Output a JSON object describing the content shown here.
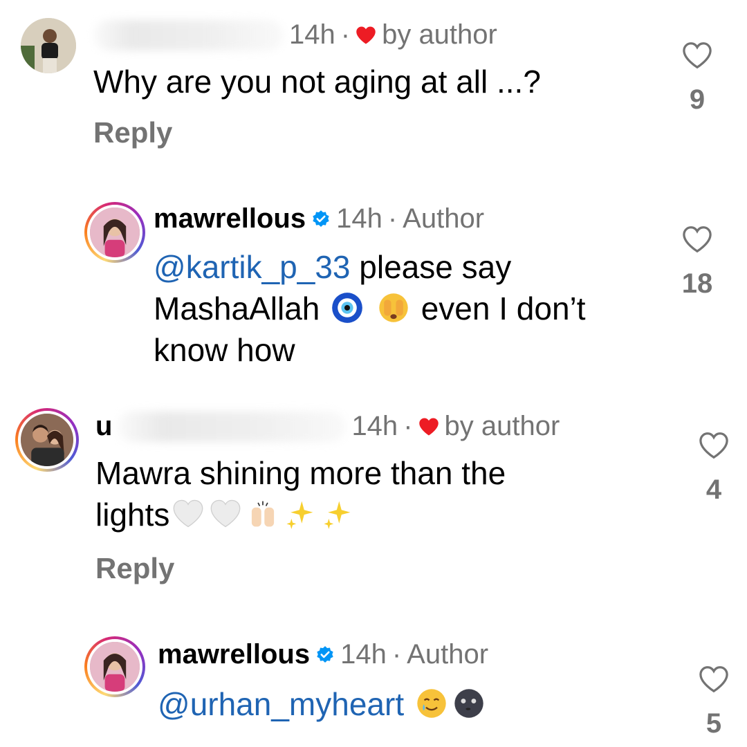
{
  "comments": [
    {
      "username_visible": "",
      "time": "14h",
      "badge": "by author",
      "text": "Why are you not aging at all ...?",
      "reply_label": "Reply",
      "likes": "9"
    },
    {
      "username": "mawrellous",
      "time": "14h",
      "badge": "Author",
      "mention": "@kartik_p_33",
      "text_part1": " please say",
      "text_part2": "MashaAllah",
      "text_part3": "even I don’t",
      "text_part4": "know how",
      "emojis": [
        "nazar-amulet-emoji",
        "face-peeking-emoji"
      ],
      "likes": "18"
    },
    {
      "username_visible": "u",
      "time": "14h",
      "badge": "by author",
      "text_part1": "Mawra shining more than the",
      "text_part2": "lights",
      "emojis": [
        "white-heart-emoji",
        "white-heart-emoji",
        "raising-hands-emoji",
        "sparkles-emoji",
        "sparkles-emoji"
      ],
      "reply_label": "Reply",
      "likes": "4"
    },
    {
      "username": "mawrellous",
      "time": "14h",
      "badge": "Author",
      "mention": "@urhan_myheart",
      "emojis": [
        "smiling-face-with-tear-emoji",
        "new-moon-face-emoji"
      ],
      "likes": "5"
    }
  ],
  "colors": {
    "muted": "#737373",
    "mention": "#1f64b3",
    "heart_red": "#ed1c24",
    "verified": "#0095f6"
  }
}
